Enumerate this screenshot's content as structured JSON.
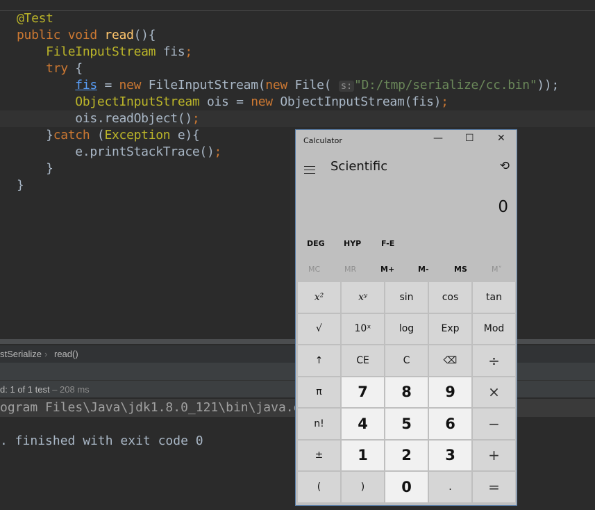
{
  "editor": {
    "lines": [
      [
        [
          "@Test",
          "an"
        ]
      ],
      [
        [
          "public void ",
          "kw"
        ],
        [
          "read",
          "fn"
        ],
        [
          "(){",
          ""
        ]
      ],
      [
        [
          "    ",
          ""
        ],
        [
          "FileInputStream",
          "ty"
        ],
        [
          " fis",
          ""
        ],
        [
          ";",
          "kw"
        ]
      ],
      [
        [
          "    ",
          ""
        ],
        [
          "try ",
          "kw"
        ],
        [
          "{",
          ""
        ]
      ],
      [
        [
          "        ",
          ""
        ],
        [
          "fis",
          "fld"
        ],
        [
          " = ",
          ""
        ],
        [
          "new ",
          "kw"
        ],
        [
          "FileInputStream(",
          ""
        ],
        [
          "new ",
          "kw"
        ],
        [
          "File( ",
          ""
        ],
        [
          "s:",
          "hint"
        ],
        [
          "\"D:/tmp/serialize/cc.bin\"",
          "st"
        ],
        [
          "));",
          ""
        ]
      ],
      [
        [
          "        ",
          ""
        ],
        [
          "ObjectInputStream",
          "ty"
        ],
        [
          " ois = ",
          ""
        ],
        [
          "new ",
          "kw"
        ],
        [
          "ObjectInputStream(fis)",
          ""
        ],
        [
          ";",
          "kw"
        ]
      ],
      [
        [
          "        ois.readObject()",
          ""
        ],
        [
          ";",
          "kw"
        ]
      ],
      [
        [
          "    }",
          ""
        ],
        [
          "catch ",
          "kw"
        ],
        [
          "(",
          ""
        ],
        [
          "Exception",
          "ty"
        ],
        [
          " e){",
          ""
        ]
      ],
      [
        [
          "        e.printStackTrace()",
          ""
        ],
        [
          ";",
          "kw"
        ]
      ],
      [
        [
          "    }",
          ""
        ]
      ],
      [
        [
          "}",
          ""
        ]
      ]
    ]
  },
  "breadcrumb": {
    "class": "stSerialize",
    "sep": "›",
    "method": "read()"
  },
  "status": {
    "prefix": "d: ",
    "passed": "1",
    "of": " of 1 test",
    "time": " – 208 ms"
  },
  "console": {
    "cmd": "ogram Files\\Java\\jdk1.8.0_121\\bin\\java.e",
    "finish": ". finished with exit code 0"
  },
  "calculator": {
    "title": "Calculator",
    "minimize": "—",
    "maximize": "☐",
    "close": "✕",
    "mode": "Scientific",
    "history": "⟲",
    "display": "0",
    "row1": [
      "DEG",
      "HYP",
      "F-E"
    ],
    "memory": [
      "MC",
      "MR",
      "M+",
      "M-",
      "MS",
      "M˅"
    ],
    "buttons": [
      [
        "x²",
        "xʸ",
        "sin",
        "cos",
        "tan"
      ],
      [
        "√",
        "10ˣ",
        "log",
        "Exp",
        "Mod"
      ],
      [
        "↑",
        "CE",
        "C",
        "⌫",
        "÷"
      ],
      [
        "π",
        "7",
        "8",
        "9",
        "×"
      ],
      [
        "n!",
        "4",
        "5",
        "6",
        "−"
      ],
      [
        "±",
        "1",
        "2",
        "3",
        "+"
      ],
      [
        "(",
        ")",
        "0",
        ".",
        "="
      ]
    ]
  }
}
